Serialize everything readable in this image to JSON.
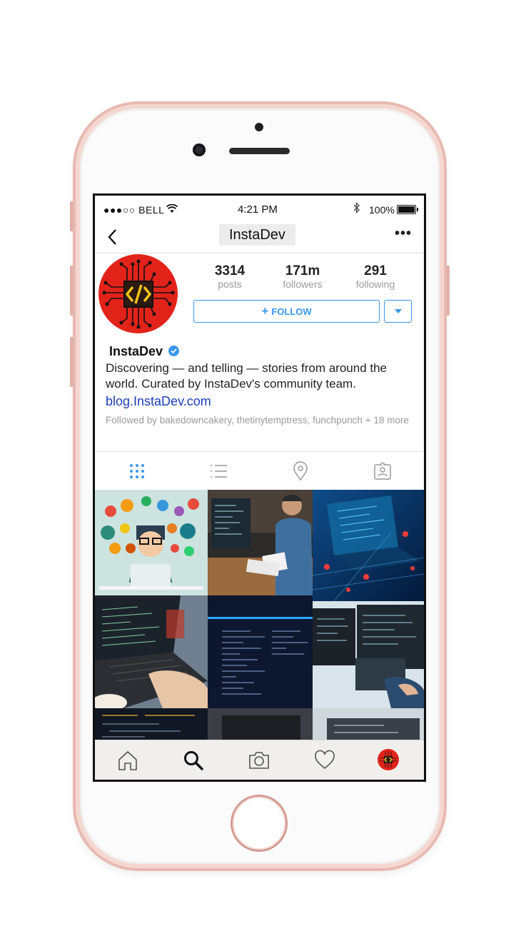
{
  "status_bar": {
    "carrier": "●●●○○ BELL",
    "time": "4:21 PM",
    "bluetooth_icon": "bluetooth-icon",
    "battery_percent": "100%"
  },
  "nav": {
    "title": "InstaDev",
    "more": "•••"
  },
  "profile": {
    "stats": [
      {
        "value": "3314",
        "label": "posts"
      },
      {
        "value": "171m",
        "label": "followers"
      },
      {
        "value": "291",
        "label": "following"
      }
    ],
    "follow_label": "FOLLOW",
    "follow_plus": "+",
    "name": "InstaDev",
    "bio": "Discovering — and telling — stories from around the world. Curated by InstaDev's  community team.",
    "link": "blog.InstaDev.com",
    "followed_by": "Followed by bakedowncakery, thetinytemptress, funchpunch + 18 more"
  },
  "tabs": [
    "grid-icon",
    "list-icon",
    "location-pin-icon",
    "tagged-user-icon"
  ],
  "bottom_nav": [
    "home-icon",
    "search-icon",
    "camera-icon",
    "heart-icon",
    "profile-avatar-icon"
  ],
  "colors": {
    "accent": "#3897f0",
    "avatar_bg": "#e2231a",
    "link": "#1a3fb8",
    "phone_frame": "#e8b9b1"
  }
}
